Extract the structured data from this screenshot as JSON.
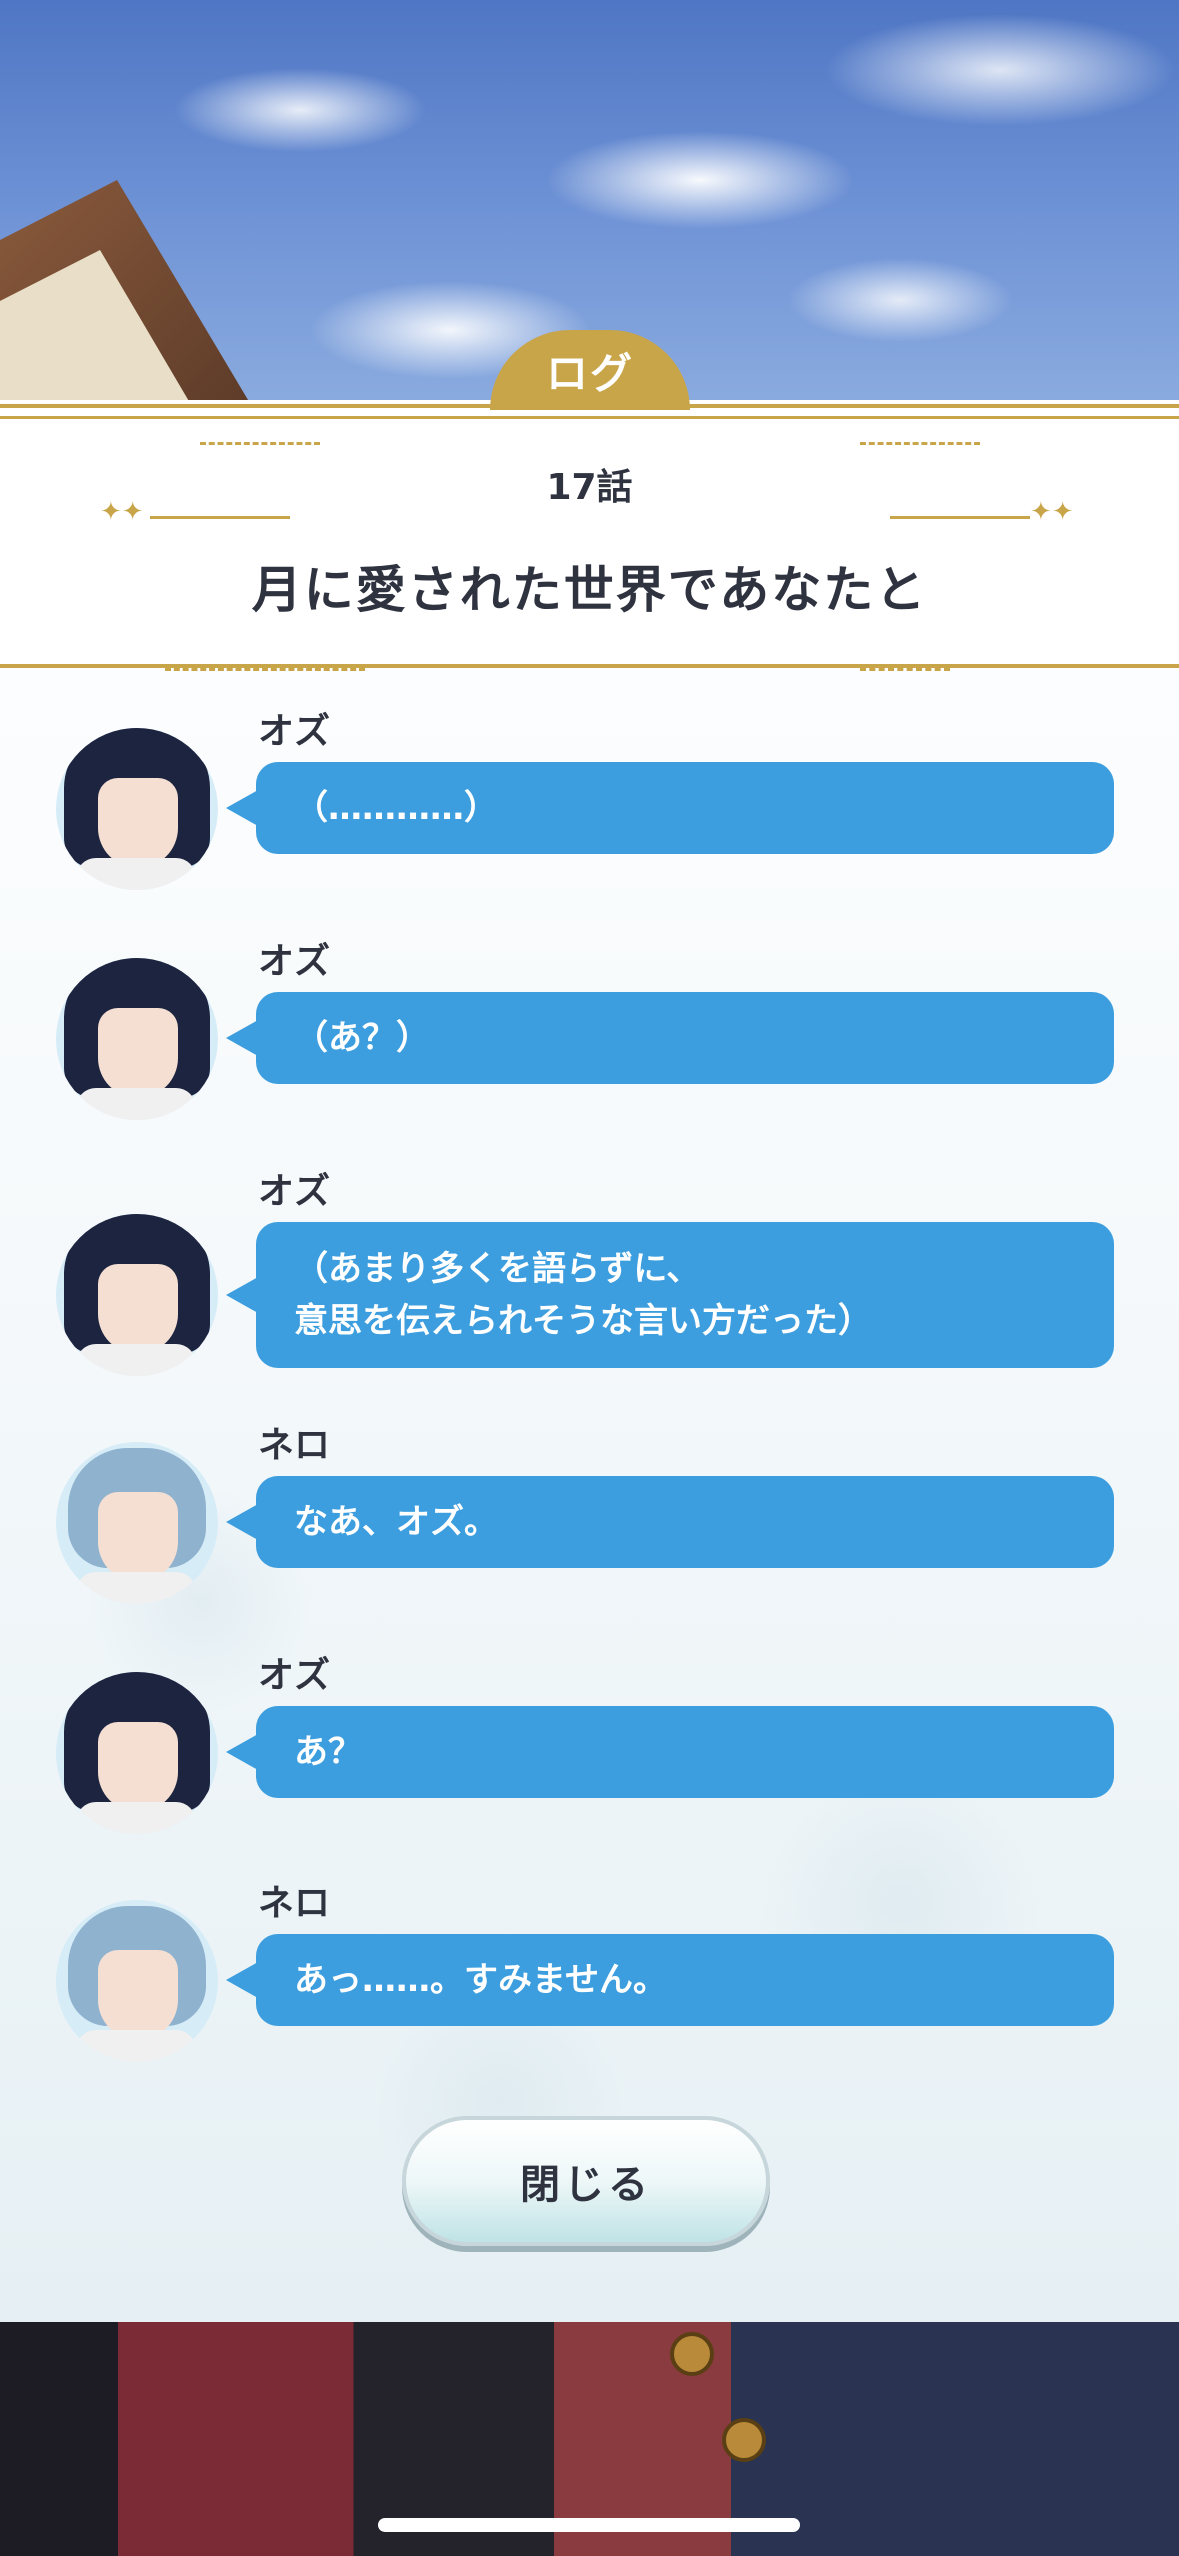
{
  "tab": {
    "label": "ログ"
  },
  "header": {
    "episode": "17話",
    "title": "月に愛された世界であなたと"
  },
  "entries": [
    {
      "speaker": "オズ",
      "lines": [
        "（…………）"
      ],
      "character": "oz"
    },
    {
      "speaker": "オズ",
      "lines": [
        "（あ？）"
      ],
      "character": "oz"
    },
    {
      "speaker": "オズ",
      "lines": [
        "（あまり多くを語らずに、",
        "意思を伝えられそうな言い方だった）"
      ],
      "character": "oz"
    },
    {
      "speaker": "ネロ",
      "lines": [
        "なあ、オズ。"
      ],
      "character": "nero"
    },
    {
      "speaker": "オズ",
      "lines": [
        "あ？"
      ],
      "character": "oz"
    },
    {
      "speaker": "ネロ",
      "lines": [
        "あっ……。すみません。"
      ],
      "character": "nero"
    }
  ],
  "close_button": {
    "label": "閉じる"
  },
  "colors": {
    "gold": "#c9a54a",
    "bubble": "#3c9ede",
    "text": "#2f3340"
  }
}
